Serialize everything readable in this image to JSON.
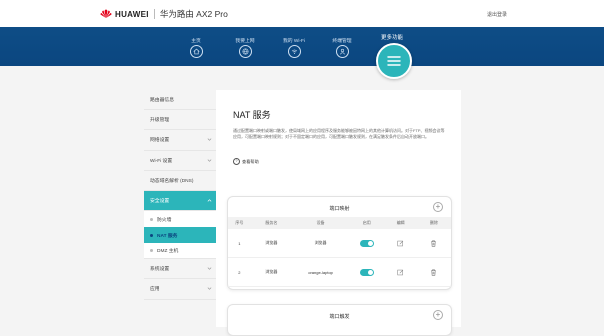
{
  "header": {
    "brand": "HUAWEI",
    "product": "华为路由 AX2 Pro",
    "logout": "退出登录"
  },
  "nav": {
    "items": [
      {
        "label": "主页",
        "icon": "home-icon"
      },
      {
        "label": "我要上网",
        "icon": "globe-icon"
      },
      {
        "label": "我的 Wi-Fi",
        "icon": "wifi-icon"
      },
      {
        "label": "终端管理",
        "icon": "user-icon"
      },
      {
        "label": "更多功能",
        "icon": "menu-icon"
      }
    ],
    "active_index": 4
  },
  "sidebar": {
    "items": [
      {
        "label": "路由器信息",
        "expandable": false
      },
      {
        "label": "升级管理",
        "expandable": false
      },
      {
        "label": "网络设置",
        "expandable": true
      },
      {
        "label": "Wi-Fi 设置",
        "expandable": true
      },
      {
        "label": "动态域名解析 (DNS)",
        "expandable": false
      },
      {
        "label": "安全设置",
        "expandable": true,
        "active": true
      }
    ],
    "subitems": [
      {
        "label": "防火墙"
      },
      {
        "label": "NAT 服务",
        "active": true
      },
      {
        "label": "DMZ 主机"
      }
    ],
    "bottom_items": [
      {
        "label": "系统设置",
        "expandable": true
      },
      {
        "label": "应用",
        "expandable": true
      }
    ]
  },
  "content": {
    "title": "NAT 服务",
    "description": "通过配置端口映射或端口触发，使局域网上的应用程序及服务能够被因特网上的其他计算机访问。对于FTP、视频会议等应用，可配置端口映射规则；对于不固定端口的应用，可配置端口触发规则，在满足触发条件后自动开放端口。",
    "help_label": "查看帮助",
    "port_mapping": {
      "title": "端口映射",
      "add_label": "+",
      "columns": [
        "序号",
        "服务名",
        "设备",
        "启用",
        "编辑",
        "删除"
      ],
      "rows": [
        {
          "index": "1",
          "service": "浏览器",
          "device": "浏览器",
          "enabled": true
        },
        {
          "index": "2",
          "service": "浏览器",
          "device": "orange-laptop",
          "enabled": true
        }
      ]
    },
    "port_trigger": {
      "title": "端口触发",
      "add_label": "+"
    }
  },
  "colors": {
    "nav_blue": "#0b4680",
    "accent_teal": "#2cb5ba",
    "background": "#f4f4f4"
  }
}
